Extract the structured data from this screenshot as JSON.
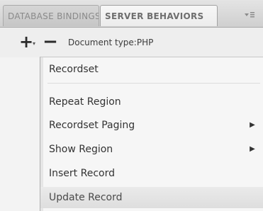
{
  "tabs": [
    {
      "label": "DATABASE BINDINGS",
      "active": false
    },
    {
      "label": "SERVER BEHAVIORS",
      "active": true
    }
  ],
  "panel_options_icon": "panel-options-icon",
  "toolbar": {
    "plus": "+",
    "minus": "−",
    "document_type": "Document type:PHP"
  },
  "menu": {
    "items": [
      {
        "label": "Recordset",
        "submenu": false
      },
      {
        "label": "Repeat Region",
        "submenu": false
      },
      {
        "label": "Recordset Paging",
        "submenu": true
      },
      {
        "label": "Show Region",
        "submenu": true
      },
      {
        "label": "Insert Record",
        "submenu": false
      },
      {
        "label": "Update Record",
        "submenu": false
      }
    ]
  },
  "colors": {
    "highlight": "#dfdfdf",
    "menu_bg": "#f6f6f6",
    "tabbar_bg": "#d4d4d4"
  }
}
